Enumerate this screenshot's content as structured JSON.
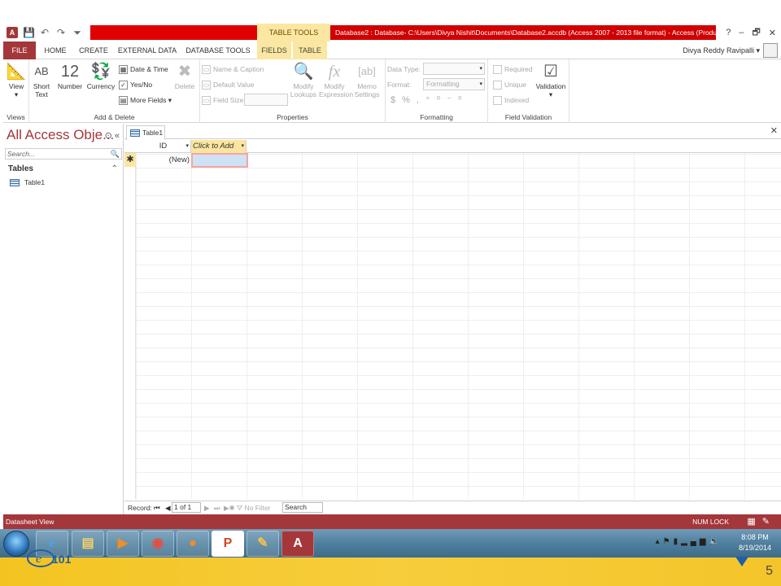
{
  "window": {
    "title": "Database2 : Database- C:\\Users\\Divya Nishit\\Documents\\Database2.accdb (Access 2007 - 2013 file format) - Access (Produ...",
    "context_tab": "TABLE TOOLS",
    "controls": [
      "?",
      "–",
      "🗗",
      "✕"
    ]
  },
  "tabs": [
    "FILE",
    "HOME",
    "CREATE",
    "EXTERNAL DATA",
    "DATABASE TOOLS",
    "FIELDS",
    "TABLE"
  ],
  "user": {
    "name": "Divya Reddy Ravipalli"
  },
  "ribbon": {
    "views": {
      "label": "Views",
      "view_btn": "View"
    },
    "add_delete": {
      "label": "Add & Delete",
      "short_text": "Short Text",
      "number": "Number",
      "currency": "Currency",
      "date_time": "Date & Time",
      "yes_no": "Yes/No",
      "more_fields": "More Fields",
      "delete": "Delete",
      "ab_icon": "AB",
      "num_icon": "12"
    },
    "properties": {
      "label": "Properties",
      "name_caption": "Name & Caption",
      "default_value": "Default Value",
      "field_size": "Field Size",
      "modify_lookups": "Modify Lookups",
      "modify_expression": "Modify Expression",
      "memo_settings": "Memo Settings"
    },
    "formatting": {
      "label": "Formatting",
      "data_type": "Data Type:",
      "format": "Format:",
      "format_value": "Formatting",
      "currency_sym": "$",
      "percent_sym": "%",
      "comma_sym": ","
    },
    "field_validation": {
      "label": "Field Validation",
      "required": "Required",
      "unique": "Unique",
      "indexed": "Indexed",
      "validation": "Validation"
    }
  },
  "nav": {
    "title": "All Access Obje...",
    "search_placeholder": "Search...",
    "section": "Tables",
    "items": [
      "Table1"
    ]
  },
  "document": {
    "tab": "Table1",
    "columns": [
      "ID",
      "Click to Add"
    ],
    "new_row_marker": "✱",
    "new_row_id": "(New)"
  },
  "record_nav": {
    "label": "Record:",
    "position": "1 of 1",
    "filter": "No Filter",
    "search": "Search"
  },
  "status": {
    "left": "Datasheet View",
    "numlock": "NUM LOCK"
  },
  "taskbar": {
    "time": "8:08 PM",
    "date": "8/19/2014"
  },
  "slide": {
    "number": "5"
  },
  "colors": {
    "access_red": "#a4373a",
    "context_yellow": "#fbe7a1",
    "title_red": "#d10000"
  }
}
